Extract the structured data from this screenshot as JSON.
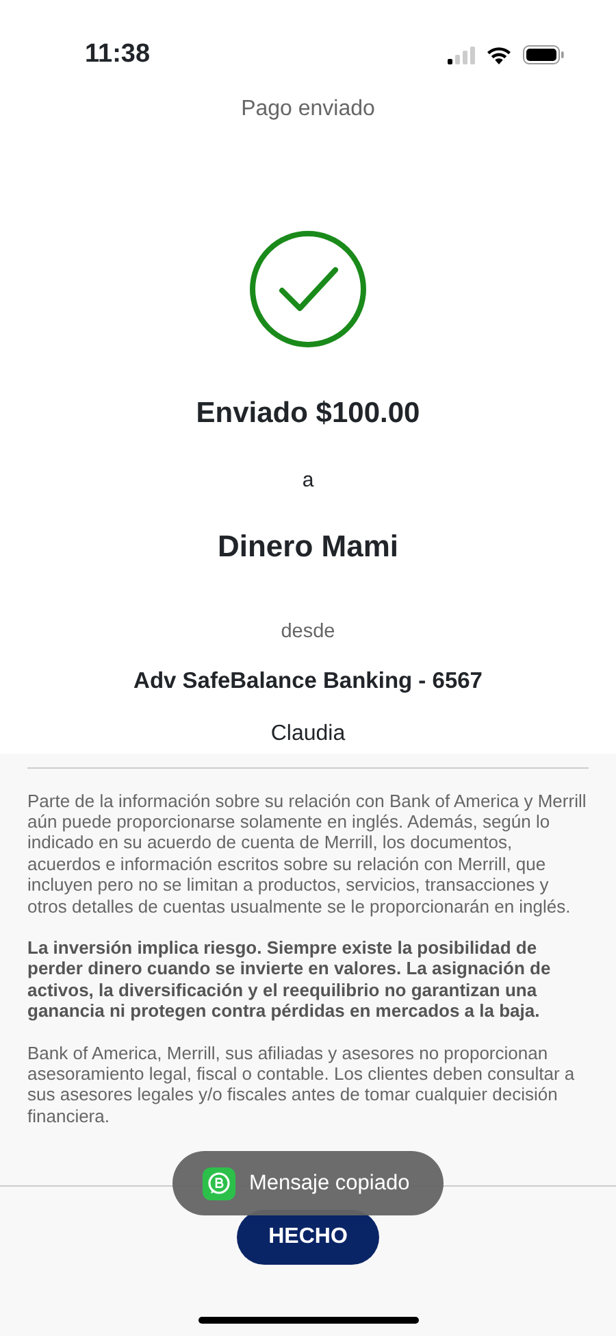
{
  "status_bar": {
    "time": "11:38"
  },
  "header": {
    "title": "Pago enviado"
  },
  "confirmation": {
    "amount_line": "Enviado $100.00",
    "connector": "a",
    "recipient": "Dinero Mami",
    "from_label": "desde",
    "account": "Adv SafeBalance Banking - 6567",
    "memo": "Claudia"
  },
  "disclosures": [
    {
      "text": "Parte de la información sobre su relación con Bank of America y Merrill aún puede proporcionarse solamente en inglés. Además, según lo indicado en su acuerdo de cuenta de Merrill, los documentos, acuerdos e información escritos sobre su relación con Merrill, que incluyen pero no se limitan a productos, servicios, transacciones y otros detalles de cuentas usualmente se le proporcionarán en inglés.",
      "bold": false
    },
    {
      "text": "La inversión implica riesgo. Siempre existe la posibilidad de perder dinero cuando se invierte en valores. La asignación de activos, la diversificación y el reequilibrio no garantizan una ganancia ni protegen contra pérdidas en mercados a la baja.",
      "bold": true
    },
    {
      "text": "Bank of America, Merrill, sus afiliadas y asesores no proporcionan asesoramiento legal, fiscal o contable. Los clientes deben consultar a sus asesores legales y/o fiscales antes de tomar cualquier decisión financiera.",
      "bold": false
    }
  ],
  "done_button": "HECHO",
  "toast": {
    "message": "Mensaje copiado"
  }
}
